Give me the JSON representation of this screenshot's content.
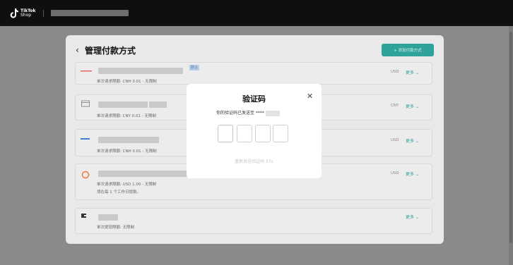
{
  "header": {
    "logo_line1": "TikTok",
    "logo_line2": "Shop"
  },
  "page": {
    "back_icon": "chevron-left-icon",
    "title": "管理付款方式",
    "add_button_label": "+ 添加付款方式"
  },
  "payment_methods": [
    {
      "icon": "card-red-line-icon",
      "limit": "单次请求限额: CNH 0.01 - 无限制",
      "currency": "USD",
      "more_label": "更多",
      "tag": "默认"
    },
    {
      "icon": "card-outline-icon",
      "limit": "单次请求限额: CNY 0.01 - 无限制",
      "currency": "CNY",
      "more_label": "更多"
    },
    {
      "icon": "card-blue-icon",
      "limit": "单次请求限额: CNH 0.01 - 无限制",
      "currency": "USD",
      "more_label": "更多"
    },
    {
      "icon": "ring-orange-icon",
      "limit": "单次请求限额: USD 1.00 - 无限制",
      "extra": "须在每 1 个工作日提款。",
      "currency": "USD",
      "more_label": "更多"
    },
    {
      "icon": "wallet-icon",
      "limit": "单次提现限额: 无限制",
      "more_label": "更多"
    }
  ],
  "modal": {
    "title": "验证码",
    "close_icon": "close-icon",
    "sent_text": "你的验证码已发送至 ****",
    "code_boxes": [
      "",
      "",
      "",
      ""
    ],
    "resend_text": "重新发送验证码 57s"
  },
  "colors": {
    "accent": "#2fa39a",
    "topbar": "#0f0f0f",
    "overlay": "#8a8a8a"
  }
}
